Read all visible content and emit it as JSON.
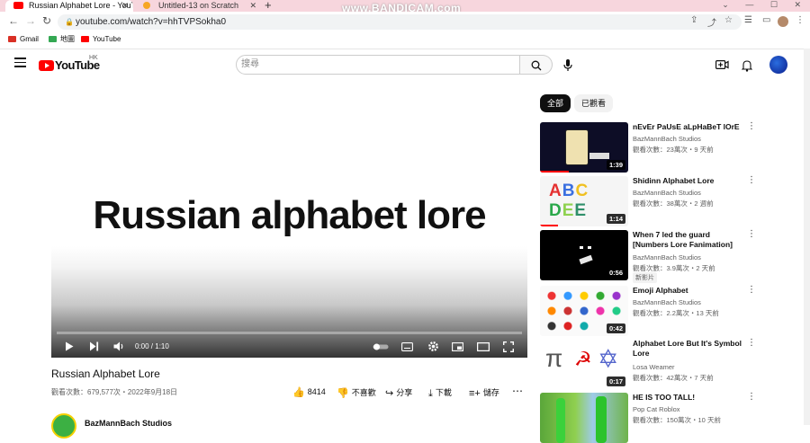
{
  "browser": {
    "tabs": [
      {
        "title": "Russian Alphabet Lore - YouTube",
        "active": true
      },
      {
        "title": "Untitled-13 on Scratch",
        "active": false
      }
    ],
    "watermark": "www.BANDICAM.com",
    "url": "youtube.com/watch?v=hhTVPSokha0",
    "bookmarks": [
      "Gmail",
      "地圖",
      "YouTube"
    ]
  },
  "header": {
    "logo_text": "YouTube",
    "region": "HK",
    "search_placeholder": "搜尋"
  },
  "player": {
    "overlay_title": "Russian alphabet lore",
    "timecode": "0:00 / 1:10"
  },
  "video": {
    "title": "Russian Alphabet Lore",
    "meta": "觀看次數：679,577次・2022年9月18日",
    "likes": "8414",
    "dislike_label": "不喜歡",
    "share_label": "分享",
    "download_label": "下載",
    "save_label": "儲存",
    "channel_name": "BazMannBach Studios"
  },
  "sidebar": {
    "chips": [
      "全部",
      "已觀看"
    ],
    "items": [
      {
        "title": "nEvEr PaUsE aLpHaBeT lOrE",
        "channel": "BazMannBach Studios",
        "stats": "觀看次數：23萬次・9 天前",
        "duration": "1:39",
        "badge": ""
      },
      {
        "title": "Shidinn Alphabet Lore",
        "channel": "BazMannBach Studios",
        "stats": "觀看次數：38萬次・2 週前",
        "duration": "1:14",
        "badge": ""
      },
      {
        "title": "When 7 led the guard [Numbers Lore Fanimation]",
        "channel": "BazMannBach Studios",
        "stats": "觀看次數：3.9萬次・2 天前",
        "duration": "0:56",
        "badge": "新影片"
      },
      {
        "title": "Emoji Alphabet",
        "channel": "BazMannBach Studios",
        "stats": "觀看次數：2.2萬次・13 天前",
        "duration": "0:42",
        "badge": ""
      },
      {
        "title": "Alphabet Lore But It's Symbol Lore",
        "channel": "Losa Weamer",
        "stats": "觀看次數：42萬次・7 天前",
        "duration": "0:17",
        "badge": ""
      },
      {
        "title": "HE IS TOO TALL!",
        "channel": "Pop Cat Roblox",
        "stats": "觀看次數：150萬次・10 天前",
        "duration": "",
        "badge": ""
      }
    ]
  },
  "colors": {
    "yt_red": "#ff0000",
    "tabstrip": "#f7d6dd",
    "chip_active": "#0f0f0f"
  }
}
